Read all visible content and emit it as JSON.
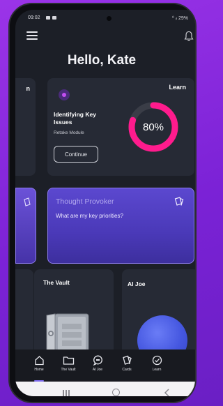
{
  "status_bar": {
    "time": "09:02",
    "right": "⁰ ᵢₗ 29%"
  },
  "header": {
    "greeting": "Hello, Kate"
  },
  "learn_card": {
    "edge_left_label": "n",
    "label": "Learn",
    "module_title": "Identifying Key Issues",
    "module_subtitle": "Retake Module",
    "continue_label": "Continue",
    "progress_text": "80%",
    "progress_value": 0.8,
    "ring_color": "#ff1b8d"
  },
  "thought_provoker": {
    "title": "Thought Provoker",
    "question": "What are my key priorities?"
  },
  "vault_card": {
    "title": "The Vault"
  },
  "aijoe_card": {
    "title": "AI Joe"
  },
  "bottom_nav": [
    {
      "label": "Home",
      "icon": "home-icon",
      "active": true
    },
    {
      "label": "The Vault",
      "icon": "folder-icon",
      "active": false
    },
    {
      "label": "AI Joe",
      "icon": "chat-icon",
      "active": false
    },
    {
      "label": "Cards",
      "icon": "cards-icon",
      "active": false
    },
    {
      "label": "Learn",
      "icon": "check-circle-icon",
      "active": false
    }
  ],
  "colors": {
    "background": "#1c1f27",
    "card": "#262a35",
    "accent": "#7e6cf0",
    "provoker": "#5b48cf"
  }
}
